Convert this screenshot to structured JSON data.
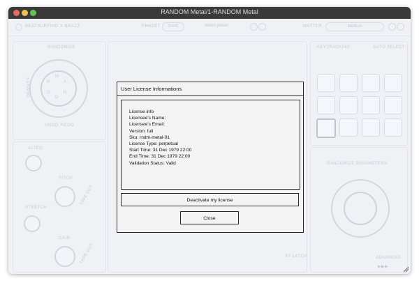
{
  "window": {
    "title": "RANDOM Metal/1-RANDOM Metal"
  },
  "plugin": {
    "brand": "BEATSURFING X BRAZZ",
    "preset_label": "PRESET",
    "save_label": "SAVE",
    "preset_select": "select preset",
    "matter_label": "MATTER",
    "matter_value": "Medium",
    "randomize_label": "RANDOMIZE",
    "density_label": "DENSITY",
    "undo_label": "UNDO",
    "redo_label": "REDO",
    "sequence_letters": [
      "M",
      "A",
      "N",
      "D",
      "O",
      "R"
    ],
    "alteo_label": "ALTEO",
    "pitch_label": "PITCH",
    "stretch_label": "STRETCH",
    "gain_label": "GAIN",
    "tape_out_label": "TAPE OUT",
    "tape_out_label_2": "TAPE OUT",
    "keytracking_label": "KEYTRACKING",
    "auto_select_label": "AUTO SELECT",
    "randomize_params_label": "RANDOMIZE PARAMETERS",
    "advanced_label": "ADVANCED",
    "xy_latch_label": "XY LATCH"
  },
  "dialog": {
    "title": "User License Informations",
    "lines": [
      "License info",
      "Licensee's Name:",
      "Licensee's Email:",
      "Version: full",
      "Sku: rndm-metal-01",
      "License Type: perpetual",
      "Start Time: 31 Dec 1979 22:00",
      "End Time: 31 Dec 1979 22:00",
      "Validation Status: Valid"
    ],
    "deactivate_label": "Deactivate my license",
    "close_label": "Close"
  }
}
